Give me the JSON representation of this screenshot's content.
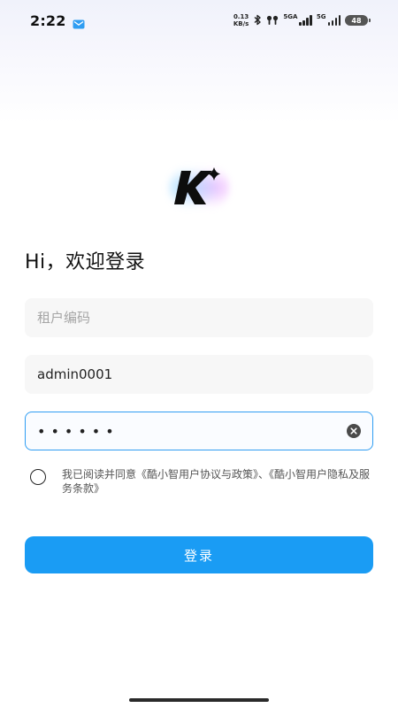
{
  "status_bar": {
    "time": "2:22",
    "net_speed_value": "0.13",
    "net_speed_unit": "KB/s",
    "signal1_label": "5GA",
    "signal2_label": "5G",
    "battery": "48"
  },
  "login": {
    "greeting": "Hi，欢迎登录",
    "tenant_placeholder": "租户编码",
    "tenant_value": "",
    "username_value": "admin0001",
    "password_value": "••••••",
    "agreement_text": "我已阅读并同意《酷小智用户协议与政策》、《酷小智用户隐私及服务条款》",
    "login_label": "登录"
  },
  "colors": {
    "accent": "#1a9cf4",
    "focus_border": "#2f9df2"
  },
  "icons": {
    "mail": "mail-icon",
    "bluetooth": "bluetooth-icon",
    "earbuds": "earbuds-icon",
    "logo": "app-logo-icon",
    "clear": "clear-icon"
  }
}
